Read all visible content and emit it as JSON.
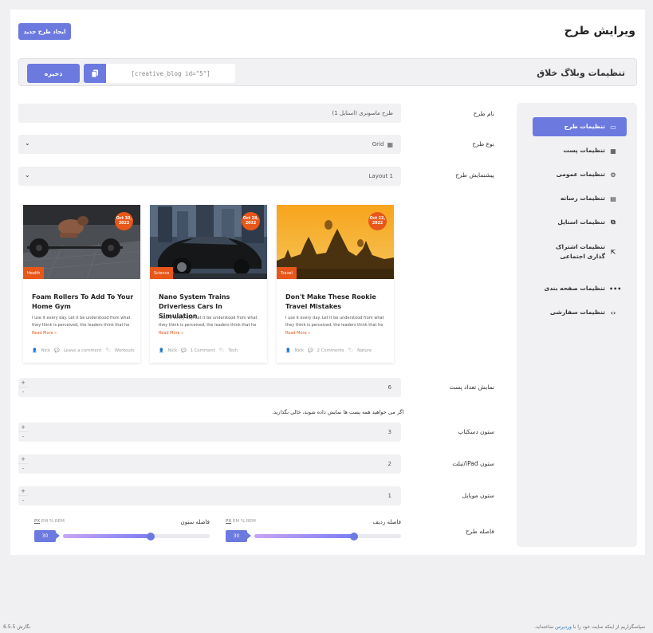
{
  "header": {
    "title": "ویرایش طرح",
    "new_button": "ایجاد طرح جدید"
  },
  "toolbar": {
    "title": "تنظیمات وبلاگ خلاق",
    "shortcode": "[creative_blog id=\"5\"]",
    "save_button": "ذخیره"
  },
  "sidebar": {
    "items": [
      {
        "label": "تنظیمات طرح",
        "icon": "layout-icon",
        "glyph": "▭",
        "active": true
      },
      {
        "label": "تنظیمات پست",
        "icon": "grid-icon",
        "glyph": "▦",
        "active": false
      },
      {
        "label": "تنظیمات عمومی",
        "icon": "gear-icon",
        "glyph": "⚙",
        "active": false
      },
      {
        "label": "تنظیمات رسانه",
        "icon": "media-icon",
        "glyph": "▤",
        "active": false
      },
      {
        "label": "تنظیمات استایل",
        "icon": "style-icon",
        "glyph": "⧉",
        "active": false
      },
      {
        "label": "تنظیمات اشتراک گذاری اجتماعی",
        "icon": "share-icon",
        "glyph": "⇱",
        "active": false
      },
      {
        "label": "تنظیمات صفحه بندی",
        "icon": "more-icon",
        "glyph": "•••",
        "active": false
      },
      {
        "label": "تنظیمات سفارشی",
        "icon": "code-icon",
        "glyph": "‹›",
        "active": false
      }
    ]
  },
  "form": {
    "name_label": "نام طرح",
    "name_value": "طرح ماسونری (استایل 1)",
    "type_label": "نوع طرح",
    "type_value": "Grid",
    "preview_label": "پیشنمایش طرح",
    "preview_value": "Layout 1",
    "posts_count_label": "نمایش تعداد پست",
    "posts_count_value": "6",
    "posts_count_hint": "اگر می خواهید همه پست ها نمایش داده شوند، خالی بگذارید.",
    "desktop_label": "ستون دسکتاپ",
    "desktop_value": "3",
    "tablet_label": "ستون iPad/تبلت",
    "tablet_value": "2",
    "mobile_label": "ستون موبایل",
    "mobile_value": "1",
    "gap_label": "فاصله طرح",
    "row_gap_label": "فاصله ردیف",
    "col_gap_label": "فاصله ستون",
    "units": [
      "PX",
      "EM",
      "%",
      "REM"
    ],
    "row_gap_value": "30",
    "col_gap_value": "30",
    "row_gap_fraction": 0.68,
    "col_gap_fraction": 0.6
  },
  "cards": [
    {
      "date_line1": "Oct 30,",
      "date_line2": "2022",
      "category": "Health",
      "title": "Foam Rollers To Add To Your Home Gym",
      "excerpt": "I use it every day. Let it be understood from what they think is perceived, the leaders think that he",
      "read_more": "Read More »",
      "author": "Nick",
      "comments": "Leave a comment",
      "tag": "Workouts"
    },
    {
      "date_line1": "Oct 28,",
      "date_line2": "2022",
      "category": "Science",
      "title": "Nano System Trains Driverless Cars In Simulation",
      "excerpt": "I use it every day. Let it be understood from what they think is perceived, the leaders think that he",
      "read_more": "Read More »",
      "author": "Nick",
      "comments": "1 Comment",
      "tag": "Tech"
    },
    {
      "date_line1": "Oct 22,",
      "date_line2": "2022",
      "category": "Travel",
      "title": "Don't Make These Rookie Travel Mistakes",
      "excerpt": "I use it every day. Let it be understood from what they think is perceived, the leaders think that he",
      "read_more": "Read More »",
      "author": "Nick",
      "comments": "2 Comments",
      "tag": "Nature"
    }
  ],
  "footer": {
    "thanks_before": "سپاسگزاریم از اینکه سایت خود را با",
    "wordpress": "وردپرس",
    "thanks_after": "ساخته‌اید.",
    "version": "نگارش 6.5.5"
  },
  "colors": {
    "accent": "#6c7ae0",
    "badge": "#e8571a",
    "field_bg": "#f1f1f4"
  }
}
